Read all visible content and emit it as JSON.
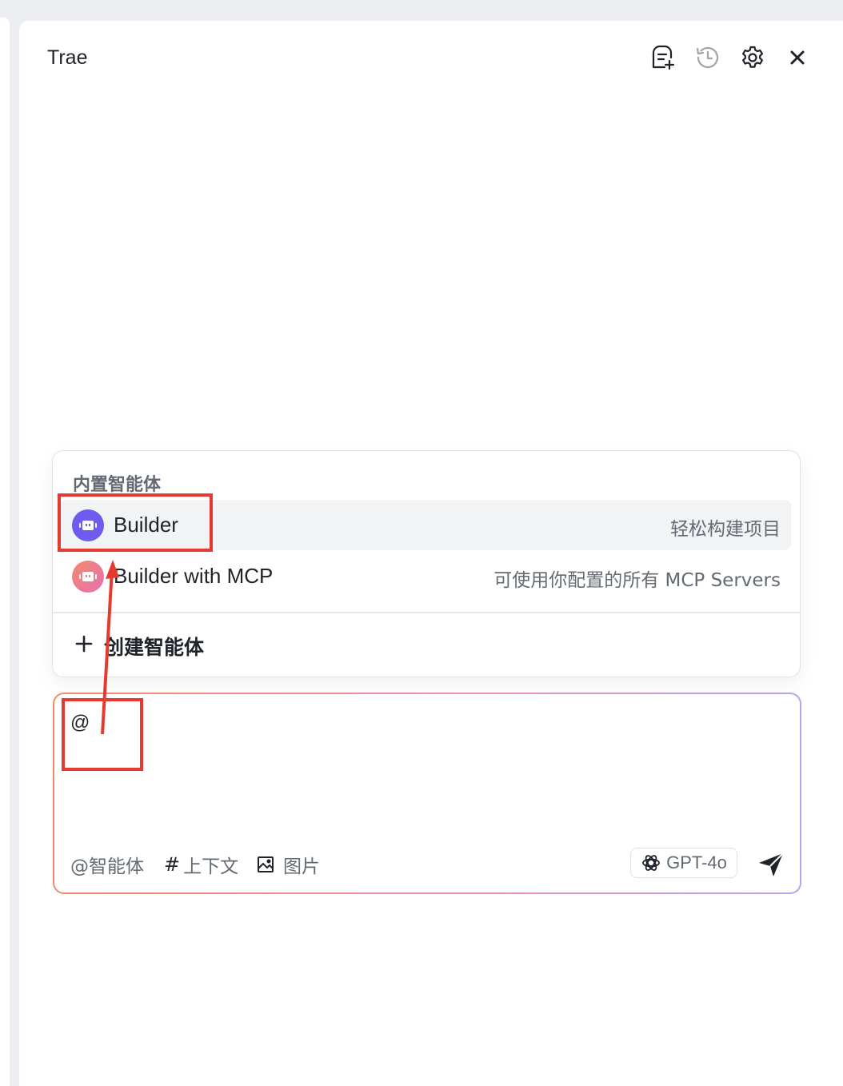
{
  "app": {
    "title": "Trae"
  },
  "header": {
    "icons": [
      "new-chat-icon",
      "history-icon",
      "gear-icon",
      "close-icon"
    ]
  },
  "agent_popup": {
    "section_title": "内置智能体",
    "agents": [
      {
        "name": "Builder",
        "description": "轻松构建项目",
        "selected": true,
        "avatar_color": "#6e5cf0"
      },
      {
        "name": "Builder with MCP",
        "description": "可使用你配置的所有 MCP Servers",
        "selected": false,
        "avatar_color": "#ec7aa0"
      }
    ],
    "create_label": "创建智能体"
  },
  "input": {
    "value": "@",
    "tools": {
      "agent": "@智能体",
      "context": "上下文",
      "image": "图片"
    },
    "model": "GPT-4o"
  },
  "annotation": {
    "color": "#e53a2f"
  }
}
